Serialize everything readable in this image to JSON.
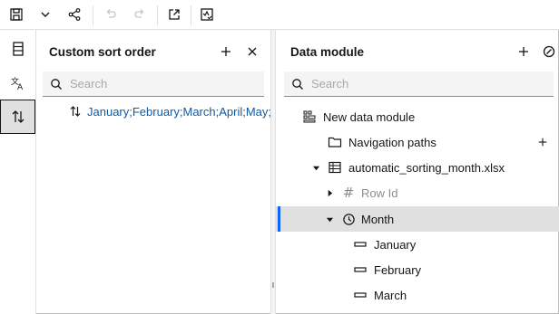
{
  "toolbar": {
    "buttons": [
      "save-icon",
      "chevron-down-icon",
      "share-icon",
      "undo-icon",
      "redo-icon",
      "launch-icon",
      "validate-icon"
    ]
  },
  "rail": {
    "items": [
      "data-module-icon",
      "translate-icon",
      "sort-order-icon"
    ],
    "active": "sort-order-icon"
  },
  "sort_panel": {
    "title": "Custom sort order",
    "search_placeholder": "Search",
    "entry": "January;February;March;April;May;June;July;August;September;October;November;December"
  },
  "data_panel": {
    "title": "Data module",
    "search_placeholder": "Search",
    "tree": {
      "module": "New data module",
      "navigation_paths": "Navigation paths",
      "file": "automatic_sorting_month.xlsx",
      "row_id": "Row Id",
      "month": "Month",
      "members": [
        "January",
        "February",
        "March"
      ]
    }
  },
  "colors": {
    "link": "#0f5ba7",
    "selection_bar": "#0f62fe",
    "selected_bg": "#e0e0e0"
  }
}
